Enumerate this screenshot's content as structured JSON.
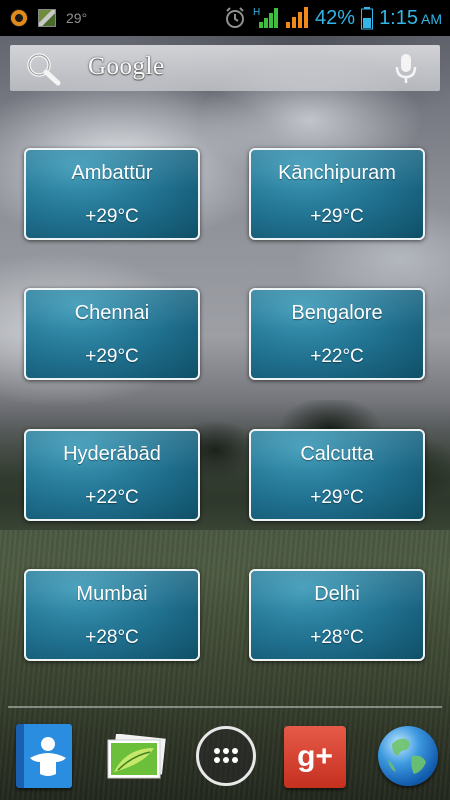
{
  "status_bar": {
    "temperature": "29°",
    "network_label": "H",
    "battery_percent": "42%",
    "time": "1:15",
    "ampm": "AM",
    "icons": [
      "app-notification-icon",
      "image-notification-icon",
      "alarm-icon",
      "signal-icon",
      "signal-icon",
      "battery-icon"
    ],
    "accent_color": "#33b5e5"
  },
  "search": {
    "label": "Google",
    "icons": [
      "search-icon",
      "mic-icon"
    ]
  },
  "widgets": [
    {
      "city": "Ambattūr",
      "temp": "+29°C"
    },
    {
      "city": "Kānchipuram",
      "temp": "+29°C"
    },
    {
      "city": "Chennai",
      "temp": "+29°C"
    },
    {
      "city": "Bengalore",
      "temp": "+22°C"
    },
    {
      "city": "Hyderābād",
      "temp": "+22°C"
    },
    {
      "city": "Calcutta",
      "temp": "+29°C"
    },
    {
      "city": "Mumbai",
      "temp": "+28°C"
    },
    {
      "city": "Delhi",
      "temp": "+28°C"
    }
  ],
  "dock": {
    "apps": [
      "contacts-icon",
      "gallery-icon",
      "app-drawer-icon",
      "google-plus-icon",
      "browser-globe-icon"
    ],
    "gplus_label": "g+"
  }
}
